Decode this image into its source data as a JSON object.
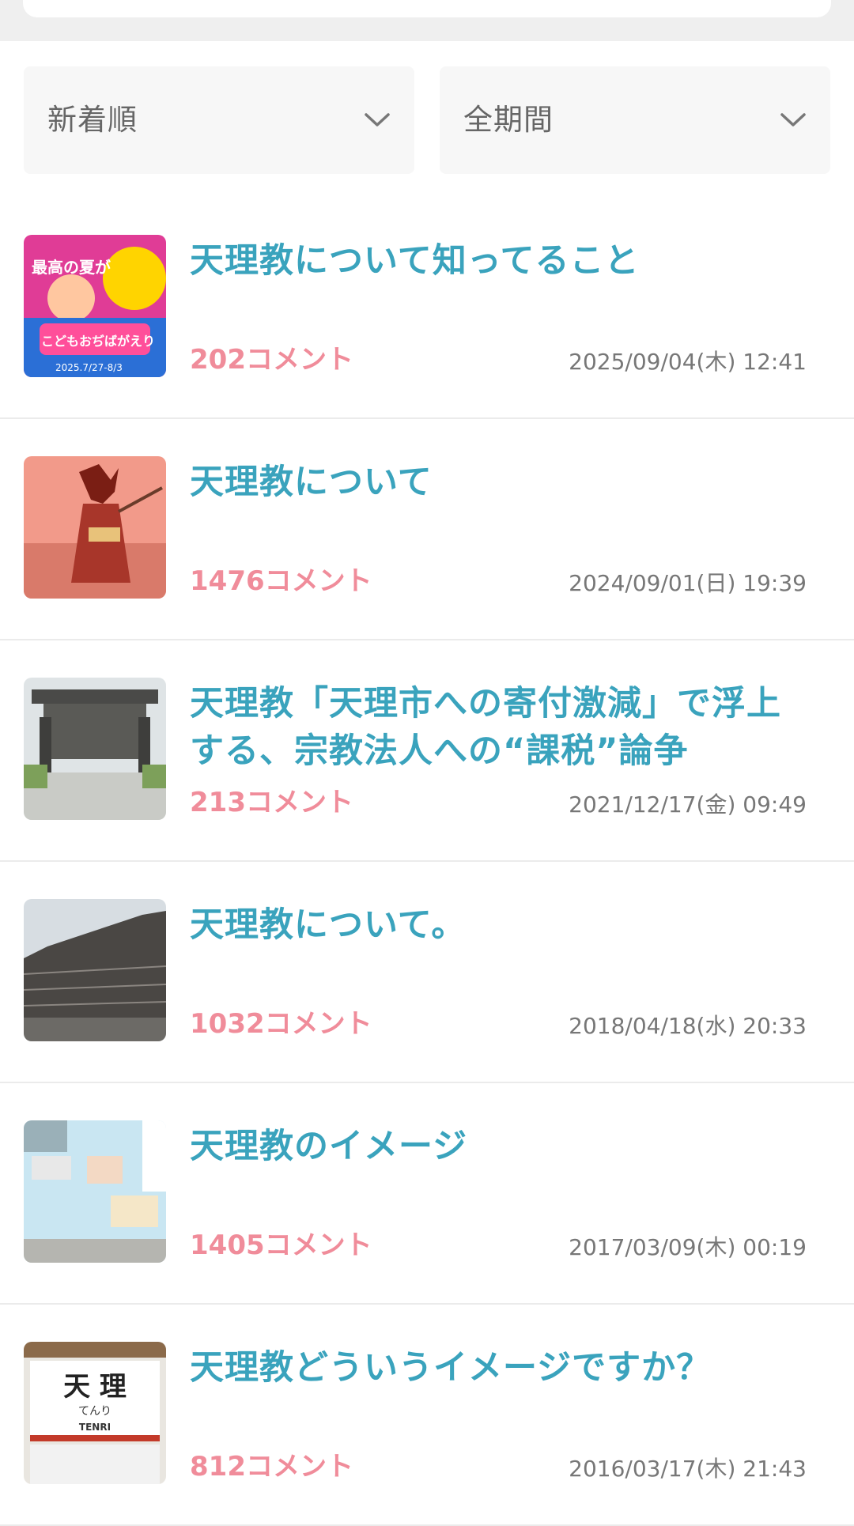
{
  "filters": {
    "sort": {
      "selected": "新着順"
    },
    "period": {
      "selected": "全期間"
    }
  },
  "topics": [
    {
      "title": "天理教について知ってること",
      "comments": "202コメント",
      "date": "2025/09/04(木) 12:41"
    },
    {
      "title": "天理教について",
      "comments": "1476コメント",
      "date": "2024/09/01(日) 19:39"
    },
    {
      "title": "天理教「天理市への寄付激減」で浮上する、宗教法人への“課税”論争",
      "comments": "213コメント",
      "date": "2021/12/17(金) 09:49"
    },
    {
      "title": "天理教について。",
      "comments": "1032コメント",
      "date": "2018/04/18(水) 20:33"
    },
    {
      "title": "天理教のイメージ",
      "comments": "1405コメント",
      "date": "2017/03/09(木) 00:19"
    },
    {
      "title": "天理教どういうイメージですか？",
      "comments": "812コメント",
      "date": "2016/03/17(木) 21:43"
    }
  ],
  "thumb_texts": {
    "t1_top": "最高の夏が",
    "t1_main": "こどもおぢばがえり",
    "t1_date": "2025.7/27-8/3",
    "t6_kanji": "天 理",
    "t6_kana": "てんり",
    "t6_roman": "TENRI"
  },
  "colors": {
    "title": "#3aa3bd",
    "comments": "#f08c9a",
    "date": "#777777"
  }
}
